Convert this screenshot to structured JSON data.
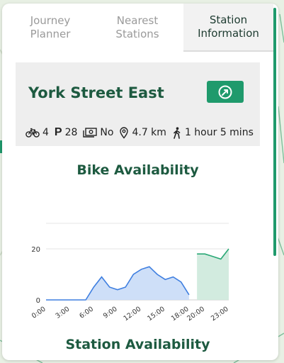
{
  "tabs": [
    {
      "line1": "Journey",
      "line2": "Planner",
      "active": false
    },
    {
      "line1": "Nearest",
      "line2": "Stations",
      "active": false
    },
    {
      "line1": "Station",
      "line2": "Information",
      "active": true
    }
  ],
  "station": {
    "name": "York Street East",
    "bikes": "4",
    "parking": "28",
    "payment": "No",
    "distance": "4.7 km",
    "walk_time": "1 hour 5 mins"
  },
  "sections": {
    "bike_availability": "Bike Availability",
    "station_availability": "Station Availability"
  },
  "colors": {
    "accent": "#1f9a6c",
    "title": "#1d5a40",
    "past_line": "#3f7fe0",
    "past_fill": "#c9dbf7",
    "forecast_line": "#2aa876",
    "forecast_fill": "#cde9dc"
  },
  "chart_data": {
    "type": "area",
    "x_tick_labels": [
      "0:00",
      "3:00",
      "6:00",
      "9:00",
      "12:00",
      "15:00",
      "18:00",
      "20:00",
      "23:00"
    ],
    "ylim": [
      0,
      30
    ],
    "y_ticks": [
      0,
      20
    ],
    "series": [
      {
        "kind": "past",
        "x": [
          0,
          1,
          2,
          3,
          4,
          5,
          6,
          7,
          8,
          9,
          10,
          11,
          12,
          13,
          14,
          15,
          16,
          17,
          18
        ],
        "y": [
          0,
          0,
          0,
          0,
          0,
          0,
          5,
          9,
          5,
          4,
          5,
          10,
          12,
          13,
          10,
          8,
          9,
          7,
          2
        ]
      },
      {
        "kind": "forecast",
        "x": [
          19,
          20,
          21,
          22,
          23
        ],
        "y": [
          18,
          18,
          17,
          16,
          20
        ]
      }
    ]
  }
}
